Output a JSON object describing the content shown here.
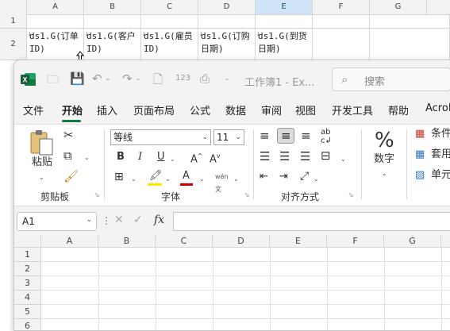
{
  "background_sheet": {
    "columns": [
      "A",
      "B",
      "C",
      "D",
      "E",
      "F",
      "G"
    ],
    "selected_column": "E",
    "rows": [
      "1",
      "2"
    ],
    "row2_cells": [
      "ds1.G(订单ID)",
      "ds1.G(客户ID)",
      "ds1.G(雇员ID)",
      "ds1.G(订购日期)",
      "ds1.G(到货日期)"
    ]
  },
  "titlebar": {
    "doc_title": "工作簿1 - Ex...",
    "search_placeholder": "搜索"
  },
  "tabs": [
    "文件",
    "开始",
    "插入",
    "页面布局",
    "公式",
    "数据",
    "审阅",
    "视图",
    "开发工具",
    "帮助",
    "Acrol"
  ],
  "active_tab": "开始",
  "ribbon": {
    "clipboard": {
      "paste_label": "粘贴",
      "group_label": "剪贴板"
    },
    "font": {
      "font_name": "等线",
      "font_size": "11",
      "group_label": "字体",
      "bold": "B",
      "italic": "I",
      "underline": "U"
    },
    "alignment": {
      "group_label": "对齐方式"
    },
    "number": {
      "label": "数字"
    },
    "styles": {
      "items": [
        "条件",
        "套用",
        "单元"
      ]
    }
  },
  "formula_bar": {
    "name_box": "A1",
    "fx": "fx",
    "value": ""
  },
  "grid": {
    "columns": [
      "A",
      "B",
      "C",
      "D",
      "E",
      "F",
      "G"
    ],
    "rows": [
      "1",
      "2",
      "3",
      "4",
      "5",
      "6"
    ]
  },
  "colors": {
    "excel_green": "#107c41",
    "selected_header": "#cfe4f7",
    "font_color_red": "#d00000",
    "highlight_yellow": "#ffe600"
  }
}
